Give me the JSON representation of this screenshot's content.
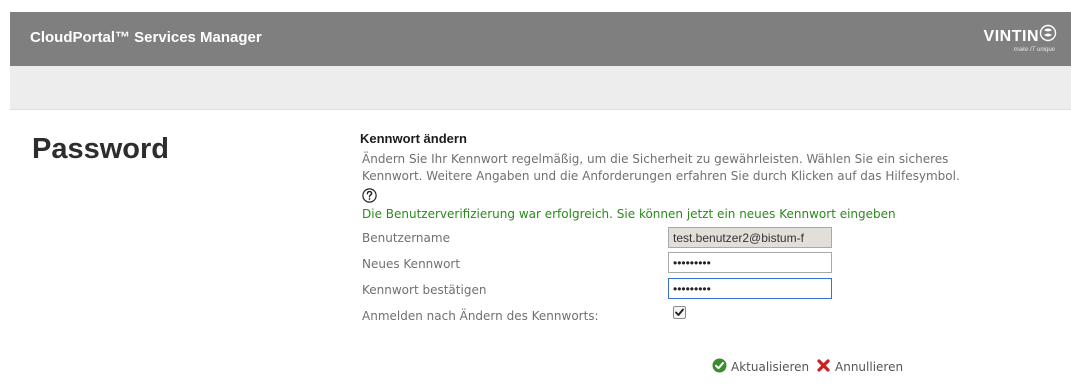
{
  "header": {
    "app_title": "CloudPortal™ Services Manager",
    "brand_name": "VINTIN",
    "brand_tagline": "make IT unique",
    "brand_icon": "vintin-logo-icon",
    "background_color": "#7f7f7f"
  },
  "page": {
    "title": "Password"
  },
  "form": {
    "section_title": "Kennwort ändern",
    "description_line1": "Ändern Sie Ihr Kennwort regelmäßig, um die Sicherheit zu gewährleisten. Wählen Sie ein sicheres",
    "description_line2": "Kennwort. Weitere Angaben und die Anforderungen erfahren Sie durch Klicken auf das Hilfesymbol.",
    "help_icon": "help-question-icon",
    "success_message": "Die Benutzerverifizierung war erfolgreich. Sie können jetzt ein neues Kennwort eingeben",
    "success_color": "#2b8a1c",
    "username_label": "Benutzername",
    "username_value": "test.benutzer2@bistum-f",
    "new_password_label": "Neues Kennwort",
    "new_password_value": "xxxxxxxxx",
    "confirm_password_label": "Kennwort bestätigen",
    "confirm_password_value": "xxxxxxxxx",
    "login_after_change_label": "Anmelden nach Ändern des Kennworts:",
    "login_after_change_checked": true
  },
  "actions": {
    "update_label": "Aktualisieren",
    "update_icon": "check-circle-icon",
    "update_color": "#3c8d2f",
    "cancel_label": "Annullieren",
    "cancel_icon": "red-x-icon",
    "cancel_color": "#cc1f1f"
  }
}
